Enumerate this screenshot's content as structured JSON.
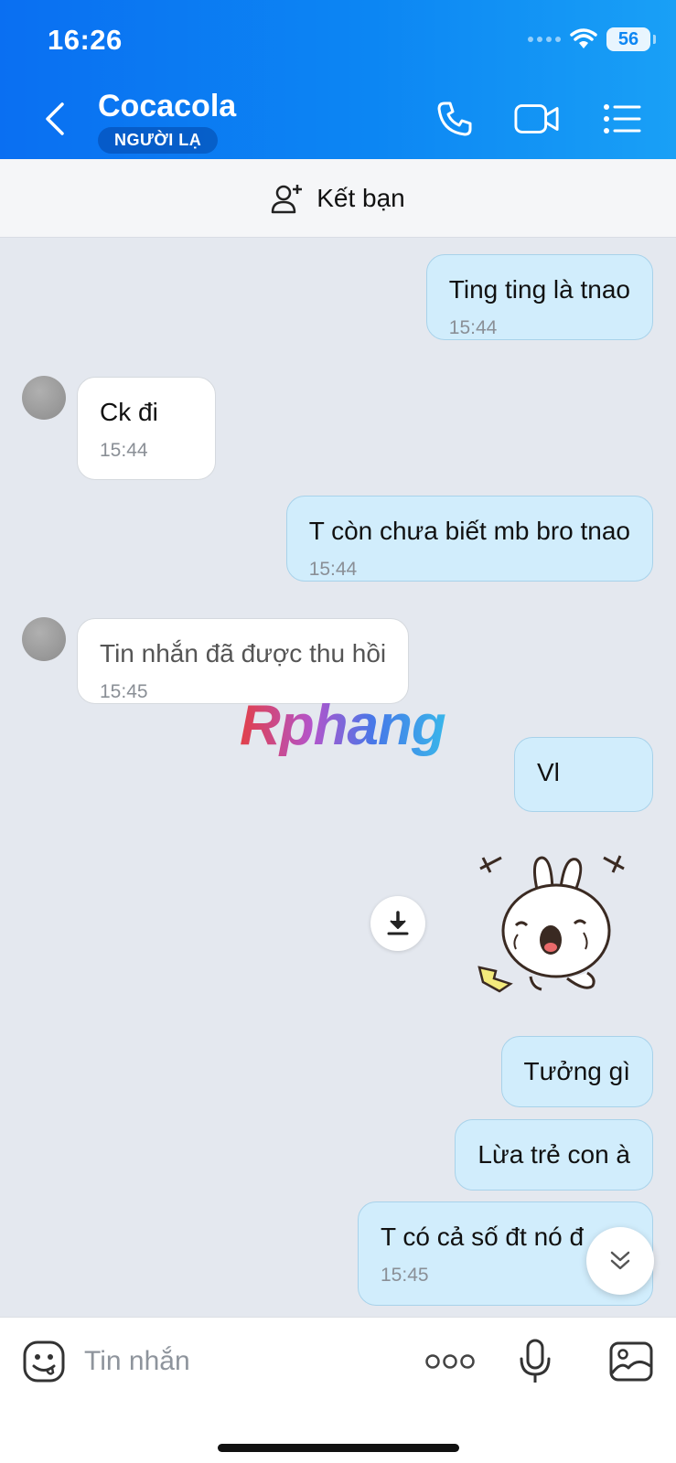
{
  "status_bar": {
    "time": "16:26",
    "battery": "56"
  },
  "header": {
    "contact_name": "Cocacola",
    "badge": "NGƯỜI LẠ",
    "icons": [
      "back-icon",
      "phone-icon",
      "video-call-icon",
      "menu-list-icon"
    ]
  },
  "friend_bar": {
    "label": "Kết bạn",
    "icon": "add-friend-icon"
  },
  "messages": [
    {
      "from": "me",
      "text": "Ting ting là tnao",
      "time": "15:44"
    },
    {
      "from": "them",
      "text": "Ck đi",
      "time": "15:44"
    },
    {
      "from": "me",
      "text": "T còn chưa biết mb bro tnao",
      "time": "15:44"
    },
    {
      "from": "them",
      "text": "Tin nhắn đã được thu hồi",
      "time": "15:45",
      "recalled": true
    },
    {
      "from": "me",
      "text": "Vl"
    },
    {
      "from": "me",
      "type": "sticker",
      "icon": "rabbit-sticker"
    },
    {
      "from": "me",
      "text": "Tưởng gì"
    },
    {
      "from": "me",
      "text": "Lừa trẻ con à"
    },
    {
      "from": "me",
      "text": "T có cả số đt nó đ",
      "time": "15:45"
    }
  ],
  "watermark": "Rphang",
  "input_bar": {
    "placeholder": "Tin nhắn",
    "icons": [
      "emoji-icon",
      "more-icon",
      "microphone-icon",
      "image-icon"
    ]
  },
  "colors": {
    "header": "#0c86f3",
    "my_bubble": "#d1edfc",
    "their_bubble": "#ffffff",
    "chat_bg": "#e4e8ef"
  }
}
